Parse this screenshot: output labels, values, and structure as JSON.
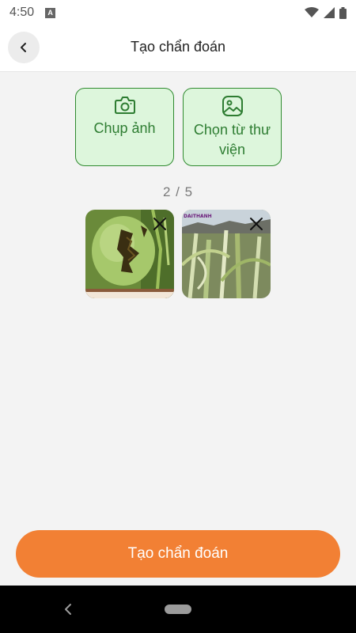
{
  "status_bar": {
    "time": "4:50",
    "notification_icon": "text-icon"
  },
  "app_bar": {
    "back_icon": "chevron-left-icon",
    "title": "Tạo chẩn đoán"
  },
  "actions": [
    {
      "icon": "camera-icon",
      "label": "Chụp ảnh"
    },
    {
      "icon": "gallery-icon",
      "label": "Chọn từ thư viện"
    }
  ],
  "counter": "2 / 5",
  "photos": [
    {
      "subject": "damaged green tomato",
      "remove_icon": "close-icon"
    },
    {
      "subject": "corn plants",
      "watermark": "DAITHANH",
      "remove_icon": "close-icon"
    }
  ],
  "submit_label": "Tạo chẩn đoán",
  "colors": {
    "accent": "#f28034",
    "green_border": "#2f8a2f",
    "green_fill": "#ddf6dc",
    "green_text": "#2e7d32"
  }
}
